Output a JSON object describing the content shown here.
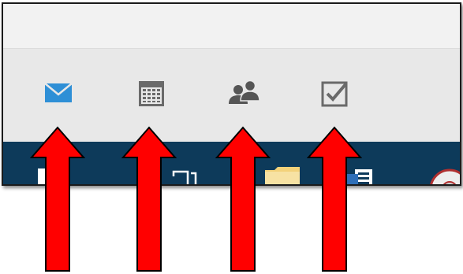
{
  "nav_icons": [
    {
      "icon": "mail-icon",
      "label": "",
      "color": "#2e8fd6"
    },
    {
      "icon": "calendar-icon",
      "label": "",
      "color": "#666666"
    },
    {
      "icon": "people-icon",
      "label": "",
      "color": "#555555"
    },
    {
      "icon": "tasks-icon",
      "label": "",
      "color": "#666666"
    }
  ],
  "taskbar_icons": [
    "desktop-icon",
    "task-view-icon",
    "folder-icon",
    "outlook-icon",
    "chrome-icon"
  ],
  "annotation": {
    "arrow_color": "#ff0000",
    "arrow_count": 4
  },
  "colors": {
    "taskbar": "#0d3a5a",
    "nav_bar": "#e8e8e8"
  }
}
